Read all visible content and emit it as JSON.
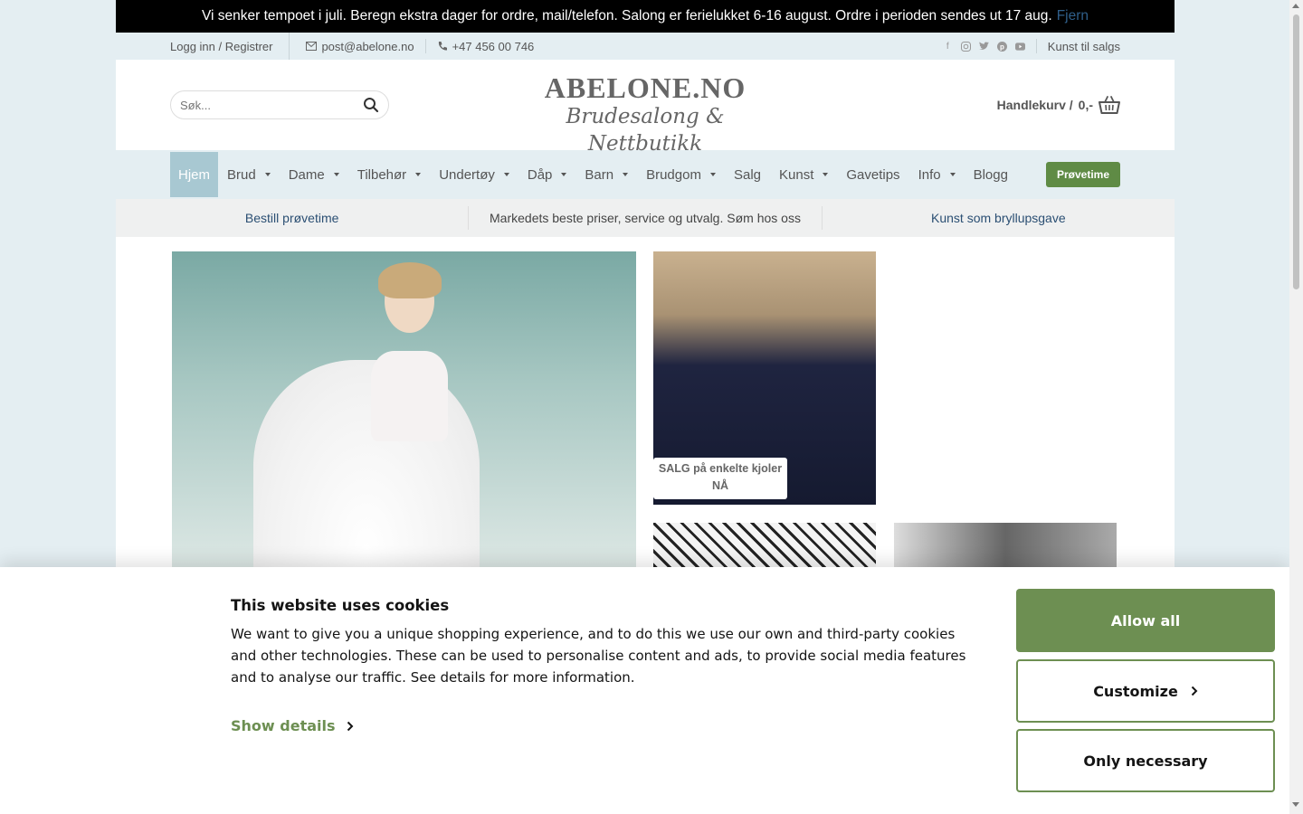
{
  "notice": {
    "text": "Vi senker tempoet i juli. Beregn ekstra dager for ordre, mail/telefon. Salong er ferielukket 6-16 august. Ordre i perioden sendes ut 17 aug.",
    "dismiss": "Fjern"
  },
  "topbar": {
    "login": "Logg inn / Registrer",
    "email": "post@abelone.no",
    "phone": "+47 456 00 746",
    "social_icons": [
      "facebook-icon",
      "instagram-icon",
      "twitter-icon",
      "pinterest-icon",
      "youtube-icon"
    ],
    "art_link": "Kunst til salgs"
  },
  "header": {
    "search_placeholder": "Søk...",
    "logo_line1": "ABELONE.NO",
    "logo_line2": "Brudesalong & Nettbutikk",
    "cart_label": "Handlekurv /",
    "cart_amount": "0,-"
  },
  "nav": {
    "items": [
      {
        "label": "Hjem",
        "dropdown": false,
        "active": true
      },
      {
        "label": "Brud",
        "dropdown": true
      },
      {
        "label": "Dame",
        "dropdown": true
      },
      {
        "label": "Tilbehør",
        "dropdown": true
      },
      {
        "label": "Undertøy",
        "dropdown": true
      },
      {
        "label": "Dåp",
        "dropdown": true
      },
      {
        "label": "Barn",
        "dropdown": true
      },
      {
        "label": "Brudgom",
        "dropdown": true
      },
      {
        "label": "Salg",
        "dropdown": false
      },
      {
        "label": "Kunst",
        "dropdown": true
      },
      {
        "label": "Gavetips",
        "dropdown": false
      },
      {
        "label": "Info",
        "dropdown": true
      },
      {
        "label": "Blogg",
        "dropdown": false
      }
    ],
    "cta": "Prøvetime"
  },
  "usp": {
    "left": "Bestill prøvetime",
    "center": "Markedets beste priser, service og utvalg. Søm hos oss",
    "right": "Kunst som bryllupsgave"
  },
  "content": {
    "sale_label": "SALG på enkelte kjoler NÅ"
  },
  "cookie": {
    "title": "This website uses cookies",
    "body": "We want to give you a unique shopping experience, and to do this we use our own and third-party cookies and other technologies. These can be used to personalise content and ads, to provide social media features and to analyse our traffic. See details for more information.",
    "show_details": "Show details",
    "allow_all": "Allow all",
    "customize": "Customize",
    "only_necessary": "Only necessary"
  },
  "colors": {
    "accent_green": "#6d8f52",
    "nav_bg": "#e4eef2",
    "nav_active": "#a8c8d2",
    "cta_green": "#5f8b45"
  }
}
